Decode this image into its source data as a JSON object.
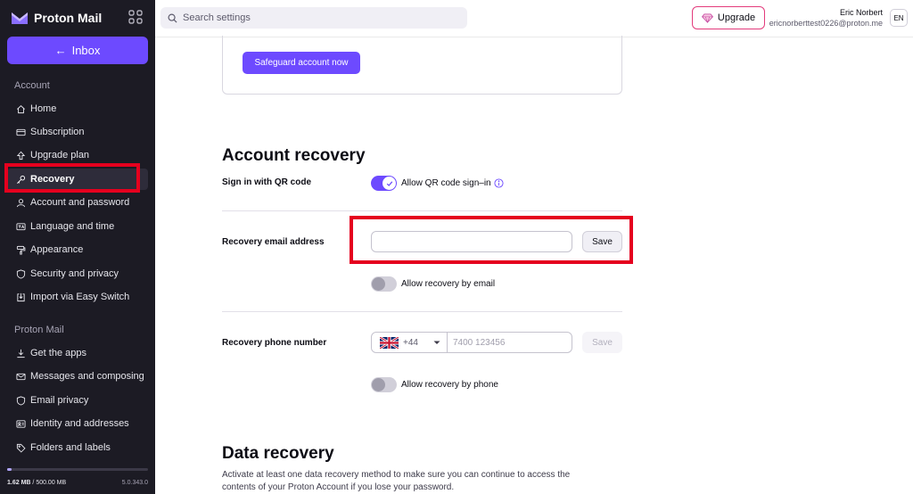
{
  "sidebar": {
    "brand": "Proton Mail",
    "inbox_label": "Inbox",
    "sections": [
      {
        "title": "Account",
        "items": [
          {
            "label": "Home",
            "icon": "home-icon"
          },
          {
            "label": "Subscription",
            "icon": "credit-card-icon"
          },
          {
            "label": "Upgrade plan",
            "icon": "arrow-up-icon"
          },
          {
            "label": "Recovery",
            "icon": "key-icon",
            "active": true
          },
          {
            "label": "Account and password",
            "icon": "user-icon"
          },
          {
            "label": "Language and time",
            "icon": "language-icon"
          },
          {
            "label": "Appearance",
            "icon": "paint-roller-icon"
          },
          {
            "label": "Security and privacy",
            "icon": "shield-icon"
          },
          {
            "label": "Import via Easy Switch",
            "icon": "import-icon"
          }
        ]
      },
      {
        "title": "Proton Mail",
        "items": [
          {
            "label": "Get the apps",
            "icon": "download-icon"
          },
          {
            "label": "Messages and composing",
            "icon": "envelope-pen-icon"
          },
          {
            "label": "Email privacy",
            "icon": "shield-icon"
          },
          {
            "label": "Identity and addresses",
            "icon": "id-card-icon"
          },
          {
            "label": "Folders and labels",
            "icon": "tag-icon"
          }
        ]
      }
    ],
    "storage": {
      "used": "1.62 MB",
      "separator": " / ",
      "total": "500.00 MB",
      "fraction": 0.0032
    },
    "version": "5.0.343.0"
  },
  "header": {
    "search_placeholder": "Search settings",
    "upgrade_label": "Upgrade",
    "user_name": "Eric Norbert",
    "user_email": "ericnorberttest0226@proton.me",
    "lang": "EN"
  },
  "main": {
    "safeguard_button": "Safeguard account now",
    "account_recovery": {
      "title": "Account recovery",
      "qr": {
        "label": "Sign in with QR code",
        "toggle_label": "Allow QR code sign–in",
        "enabled": true
      },
      "email": {
        "label": "Recovery email address",
        "value": "",
        "save_label": "Save",
        "toggle_label": "Allow recovery by email",
        "enabled": false
      },
      "phone": {
        "label": "Recovery phone number",
        "country_code": "+44",
        "placeholder": "7400 123456",
        "save_label": "Save",
        "toggle_label": "Allow recovery by phone",
        "enabled": false
      }
    },
    "data_recovery": {
      "title": "Data recovery",
      "description": "Activate at least one data recovery method to make sure you can continue to access the contents of your Proton Account if you lose your password."
    }
  },
  "colors": {
    "accent": "#6d4aff",
    "sidebar_bg": "#1c1b24",
    "highlight": "#e5001e"
  }
}
